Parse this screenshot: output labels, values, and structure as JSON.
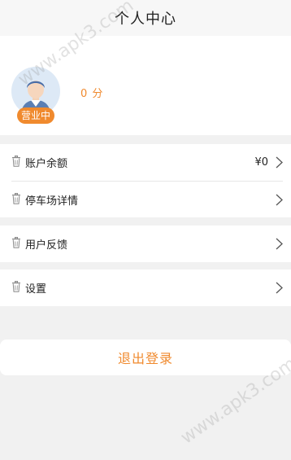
{
  "header": {
    "title": "个人中心"
  },
  "profile": {
    "status_badge": "营业中",
    "points": "0 分"
  },
  "menu": {
    "balance_label": "账户余额",
    "balance_value": "¥0",
    "parking_label": "停车场详情",
    "feedback_label": "用户反馈",
    "settings_label": "设置"
  },
  "logout": {
    "label": "退出登录"
  },
  "watermark": {
    "text": "www.apk3.com"
  },
  "colors": {
    "accent": "#f08a2e",
    "background": "#f1f1f1",
    "card": "#ffffff"
  },
  "icons": [
    "avatar-icon",
    "trash-icon",
    "chevron-right-icon"
  ]
}
